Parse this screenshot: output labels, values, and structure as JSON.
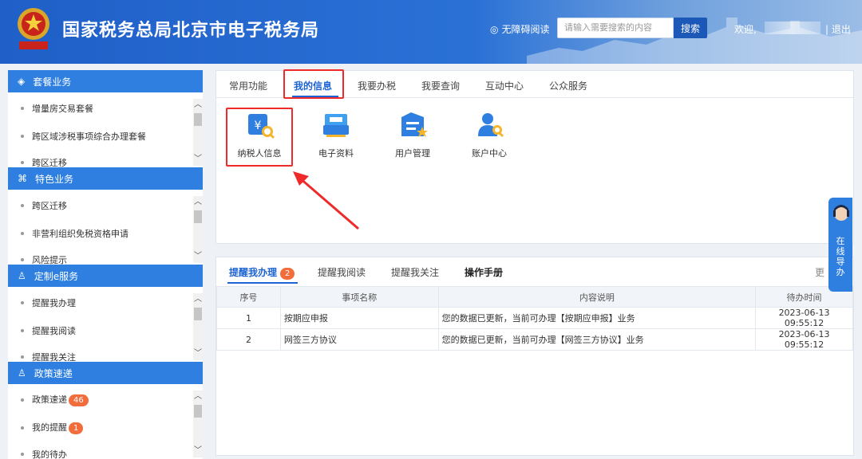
{
  "header": {
    "title": "国家税务总局北京市电子税务局",
    "accessibility": "无障碍阅读",
    "search_placeholder": "请输入需要搜索的内容",
    "search_button": "搜索",
    "welcome": "欢迎,",
    "logout": "| 退出"
  },
  "sidebar": {
    "sections": [
      {
        "title": "套餐业务",
        "icon": "layers-icon",
        "items": [
          {
            "label": "增量房交易套餐"
          },
          {
            "label": "跨区域涉税事项综合办理套餐"
          },
          {
            "label": "跨区迁移"
          }
        ]
      },
      {
        "title": "特色业务",
        "icon": "grid-clover-icon",
        "items": [
          {
            "label": "跨区迁移"
          },
          {
            "label": "非营利组织免税资格申请"
          },
          {
            "label": "风险提示"
          }
        ]
      },
      {
        "title": "定制e服务",
        "icon": "user-icon",
        "items": [
          {
            "label": "提醒我办理"
          },
          {
            "label": "提醒我阅读"
          },
          {
            "label": "提醒我关注"
          }
        ]
      },
      {
        "title": "政策速递",
        "icon": "user-icon",
        "items": [
          {
            "label": "政策速递",
            "badge": "46"
          },
          {
            "label": "我的提醒",
            "badge": "1"
          },
          {
            "label": "我的待办"
          }
        ]
      }
    ]
  },
  "main_tabs": [
    "常用功能",
    "我的信息",
    "我要办税",
    "我要查询",
    "互动中心",
    "公众服务"
  ],
  "active_tab": "我的信息",
  "functions": [
    {
      "label": "纳税人信息",
      "icon": "taxpayer-info-icon"
    },
    {
      "label": "电子资料",
      "icon": "electronic-files-icon"
    },
    {
      "label": "用户管理",
      "icon": "user-management-icon"
    },
    {
      "label": "账户中心",
      "icon": "account-center-icon"
    }
  ],
  "reminder_tabs": {
    "items": [
      "提醒我办理",
      "提醒我阅读",
      "提醒我关注",
      "操作手册"
    ],
    "active_count": "2",
    "more": "更"
  },
  "table": {
    "headers": [
      "序号",
      "事项名称",
      "内容说明",
      "待办时间"
    ],
    "rows": [
      {
        "no": "1",
        "name": "按期应申报",
        "desc": "您的数据已更新，当前可办理【按期应申报】业务",
        "time": "2023-06-13 09:55:12"
      },
      {
        "no": "2",
        "name": "网签三方协议",
        "desc": "您的数据已更新，当前可办理【网签三方协议】业务",
        "time": "2023-06-13 09:55:12"
      }
    ]
  },
  "guide": {
    "label": "在线导办"
  },
  "colors": {
    "primary": "#2f7fe0",
    "highlight": "#ee2a2a",
    "badge": "#f26d3b"
  }
}
